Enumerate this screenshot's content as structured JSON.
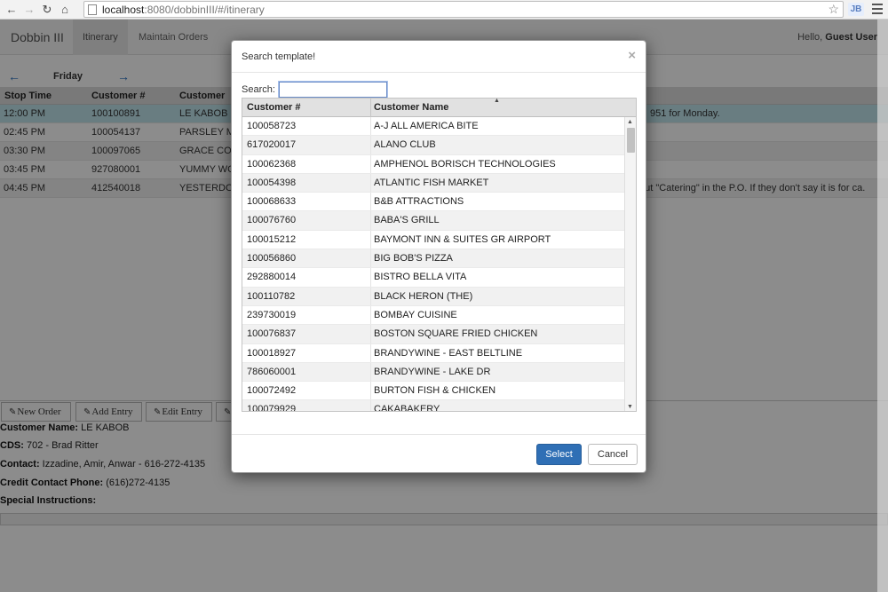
{
  "browser": {
    "back_icon": "arrow-left-icon",
    "url_host": "localhost",
    "url_path": ":8080/dobbinIII/#/itinerary",
    "extension_label": "JB"
  },
  "navbar": {
    "brand": "Dobbin III",
    "tabs": [
      {
        "label": "Itinerary",
        "active": true
      },
      {
        "label": "Maintain Orders",
        "active": false
      }
    ],
    "greeting_prefix": "Hello, ",
    "user": "Guest User"
  },
  "day_nav": {
    "day": "Friday"
  },
  "itinerary": {
    "columns": [
      "Stop Time",
      "Customer #",
      "Customer"
    ],
    "rows": [
      {
        "time": "12:00 PM",
        "customer_no": "100100891",
        "customer": "LE KABOB",
        "note": "951 for Monday."
      },
      {
        "time": "02:45 PM",
        "customer_no": "100054137",
        "customer": "PARSLEY M",
        "note": ""
      },
      {
        "time": "03:30 PM",
        "customer_no": "100097065",
        "customer": "GRACE CO",
        "note": ""
      },
      {
        "time": "03:45 PM",
        "customer_no": "927080001",
        "customer": "YUMMY WO",
        "note": ""
      },
      {
        "time": "04:45 PM",
        "customer_no": "412540018",
        "customer": "YESTERDO",
        "note": "put \"Catering\" in the P.O. If they don't say it is for ca."
      }
    ]
  },
  "toolbar": {
    "buttons": [
      "New Order",
      "Add Entry",
      "Edit Entry"
    ]
  },
  "details": {
    "customer_name_label": "Customer Name:",
    "customer_name": "LE KABOB",
    "cds_label": "CDS:",
    "cds": "702 - Brad Ritter",
    "contact_label": "Contact:",
    "contact": "Izzadine, Amir, Anwar - 616-272-4135",
    "credit_phone_label": "Credit Contact Phone:",
    "credit_phone": "(616)272-4135",
    "special_label": "Special Instructions:"
  },
  "modal": {
    "title": "Search template!",
    "close": "×",
    "search_label": "Search:",
    "search_value": "",
    "columns": [
      "Customer #",
      "Customer Name"
    ],
    "rows": [
      {
        "no": "100058723",
        "name": "A-J ALL AMERICA BITE"
      },
      {
        "no": "617020017",
        "name": "ALANO CLUB"
      },
      {
        "no": "100062368",
        "name": "AMPHENOL BORISCH TECHNOLOGIES"
      },
      {
        "no": "100054398",
        "name": "ATLANTIC FISH MARKET"
      },
      {
        "no": "100068633",
        "name": "B&B ATTRACTIONS"
      },
      {
        "no": "100076760",
        "name": "BABA'S GRILL"
      },
      {
        "no": "100015212",
        "name": "BAYMONT INN & SUITES GR AIRPORT"
      },
      {
        "no": "100056860",
        "name": "BIG BOB'S PIZZA"
      },
      {
        "no": "292880014",
        "name": "BISTRO BELLA VITA"
      },
      {
        "no": "100110782",
        "name": "BLACK HERON (THE)"
      },
      {
        "no": "239730019",
        "name": "BOMBAY CUISINE"
      },
      {
        "no": "100076837",
        "name": "BOSTON SQUARE FRIED CHICKEN"
      },
      {
        "no": "100018927",
        "name": "BRANDYWINE - EAST BELTLINE"
      },
      {
        "no": "786060001",
        "name": "BRANDYWINE - LAKE DR"
      },
      {
        "no": "100072492",
        "name": "BURTON FISH & CHICKEN"
      },
      {
        "no": "100079929",
        "name": "CAKABAKERY"
      }
    ],
    "select_label": "Select",
    "cancel_label": "Cancel"
  }
}
